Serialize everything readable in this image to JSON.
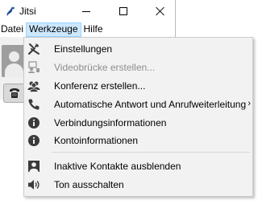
{
  "window": {
    "title": "Jitsi"
  },
  "menubar": {
    "items": [
      "Datei",
      "Werkzeuge",
      "Hilfe"
    ]
  },
  "menu": {
    "items": [
      {
        "label": "Einstellungen",
        "icon": "tools-icon",
        "enabled": true
      },
      {
        "label": "Videobrücke erstellen...",
        "icon": "video-bridge-icon",
        "enabled": false
      },
      {
        "label": "Konferenz erstellen...",
        "icon": "conference-icon",
        "enabled": true
      },
      {
        "label": "Automatische Antwort und Anrufweiterleitung",
        "icon": "phone-icon",
        "enabled": true,
        "submenu": true
      },
      {
        "label": "Verbindungsinformationen",
        "icon": "info-icon",
        "enabled": true
      },
      {
        "label": "Kontoinformationen",
        "icon": "info-icon",
        "enabled": true
      },
      {
        "label": "Inaktive Kontakte ausblenden",
        "icon": "contact-icon",
        "enabled": true
      },
      {
        "label": "Ton ausschalten",
        "icon": "speaker-icon",
        "enabled": true
      }
    ],
    "submenu_arrow": "›"
  },
  "colors": {
    "menu_bg": "#f2f2f2",
    "menu_active": "#cce8ff",
    "disabled_text": "#8d8d8d",
    "icon": "#3b3b3b"
  }
}
